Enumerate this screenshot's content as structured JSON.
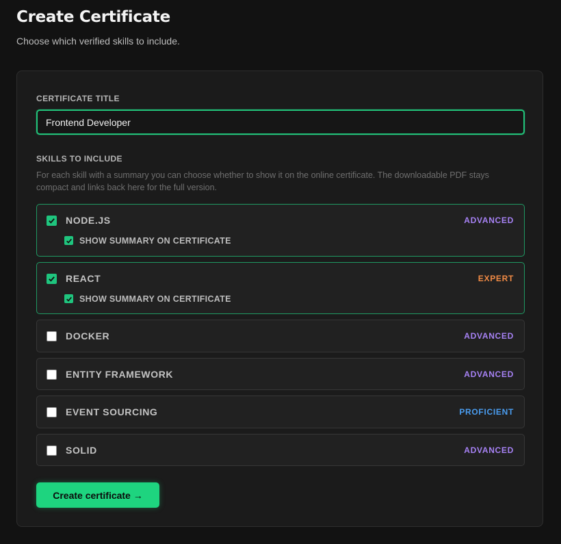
{
  "header": {
    "title": "Create Certificate",
    "subtitle": "Choose which verified skills to include."
  },
  "form": {
    "title_label": "CERTIFICATE TITLE",
    "title_value": "Frontend Developer",
    "skills_label": "SKILLS TO INCLUDE",
    "skills_help": "For each skill with a summary you can choose whether to show it on the online certificate. The downloadable PDF stays compact and links back here for the full version.",
    "summary_toggle_label": "SHOW SUMMARY ON CERTIFICATE",
    "skills": [
      {
        "name": "NODE.JS",
        "level": "ADVANCED",
        "checked": true,
        "show_summary": true
      },
      {
        "name": "REACT",
        "level": "EXPERT",
        "checked": true,
        "show_summary": true
      },
      {
        "name": "DOCKER",
        "level": "ADVANCED",
        "checked": false
      },
      {
        "name": "ENTITY FRAMEWORK",
        "level": "ADVANCED",
        "checked": false
      },
      {
        "name": "EVENT SOURCING",
        "level": "PROFICIENT",
        "checked": false
      },
      {
        "name": "SOLID",
        "level": "ADVANCED",
        "checked": false
      }
    ],
    "submit_label": "Create certificate →"
  },
  "colors": {
    "accent": "#1ed47f",
    "advanced": "#a782f5",
    "expert": "#f08a45",
    "proficient": "#4a9df0"
  }
}
